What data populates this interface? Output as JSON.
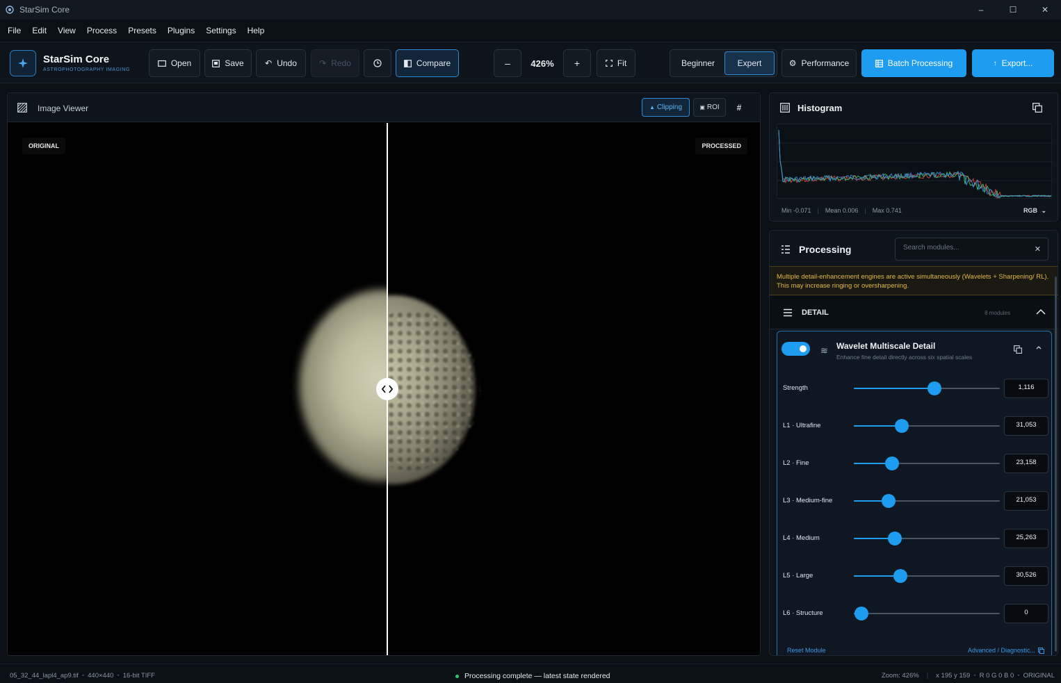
{
  "window": {
    "title": "StarSim Core",
    "controls": [
      "–",
      "☐",
      "✕"
    ]
  },
  "menu": [
    "File",
    "Edit",
    "View",
    "Process",
    "Presets",
    "Plugins",
    "Settings",
    "Help"
  ],
  "toolbar": {
    "brand_name": "StarSim Core",
    "brand_sub": "ASTROPHOTOGRAPHY IMAGING",
    "open_label": "Open",
    "save_label": "Save",
    "undo_label": "Undo",
    "redo_label": "Redo",
    "compare_label": "Compare",
    "zoom_out": "–",
    "zoom_value": "426%",
    "zoom_in": "+",
    "fit_label": "Fit",
    "mode_beginner": "Beginner",
    "mode_expert": "Expert",
    "mode_selected": "Expert",
    "performance_label": "Performance",
    "batch_label": "Batch Processing",
    "export_label": "Export..."
  },
  "viewer": {
    "title": "Image Viewer",
    "clipping_label": "Clipping",
    "roi_label": "ROI",
    "grid_label": "#",
    "tag_original": "ORIGINAL",
    "tag_processed": "PROCESSED",
    "split_position": 0.505
  },
  "histogram": {
    "title": "Histogram",
    "min": "Min -0.071",
    "mean": "Mean 0.006",
    "max": "Max 0.741",
    "channel": "RGB",
    "channel_chevron": "⌄",
    "colors": {
      "red": "#e0463c",
      "green": "#3ec46a",
      "blue": "#3a8fe8"
    }
  },
  "processing": {
    "title": "Processing",
    "search_placeholder": "Search modules...",
    "search_clear": "✕",
    "warning": "Multiple detail-enhancement engines are active simultaneously (Wavelets + Sharpening/ RL). This may increase ringing or oversharpening.",
    "section_title": "DETAIL",
    "section_count": "8 modules",
    "module": {
      "enabled": true,
      "icon": "≋",
      "title": "Wavelet Multiscale Detail",
      "subtitle": "Enhance fine detail directly across six spatial scales",
      "params": [
        {
          "label": "Strength",
          "value": "1,116",
          "fraction": 0.55
        },
        {
          "label": "L1 · Ultrafine",
          "value": "31,053",
          "fraction": 0.33
        },
        {
          "label": "L2 · Fine",
          "value": "23,158",
          "fraction": 0.26
        },
        {
          "label": "L3 · Medium-fine",
          "value": "21,053",
          "fraction": 0.24
        },
        {
          "label": "L4 · Medium",
          "value": "25,263",
          "fraction": 0.28
        },
        {
          "label": "L5 · Large",
          "value": "30,526",
          "fraction": 0.32
        },
        {
          "label": "L6 · Structure",
          "value": "0",
          "fraction": 0.05
        }
      ],
      "reset_label": "Reset Module",
      "advanced_label": "Advanced / Diagnostic..."
    }
  },
  "status": {
    "file": "05_32_44_lapl4_ap9.tif",
    "dims": "440×440",
    "format": "16-bit TIFF",
    "message": "Processing complete — latest state rendered",
    "zoom": "Zoom: 426%",
    "coords": "x 195  y 159",
    "rgb": "R 0  G 0  B 0",
    "view": "ORIGINAL"
  },
  "accent": "#1e9cf0"
}
